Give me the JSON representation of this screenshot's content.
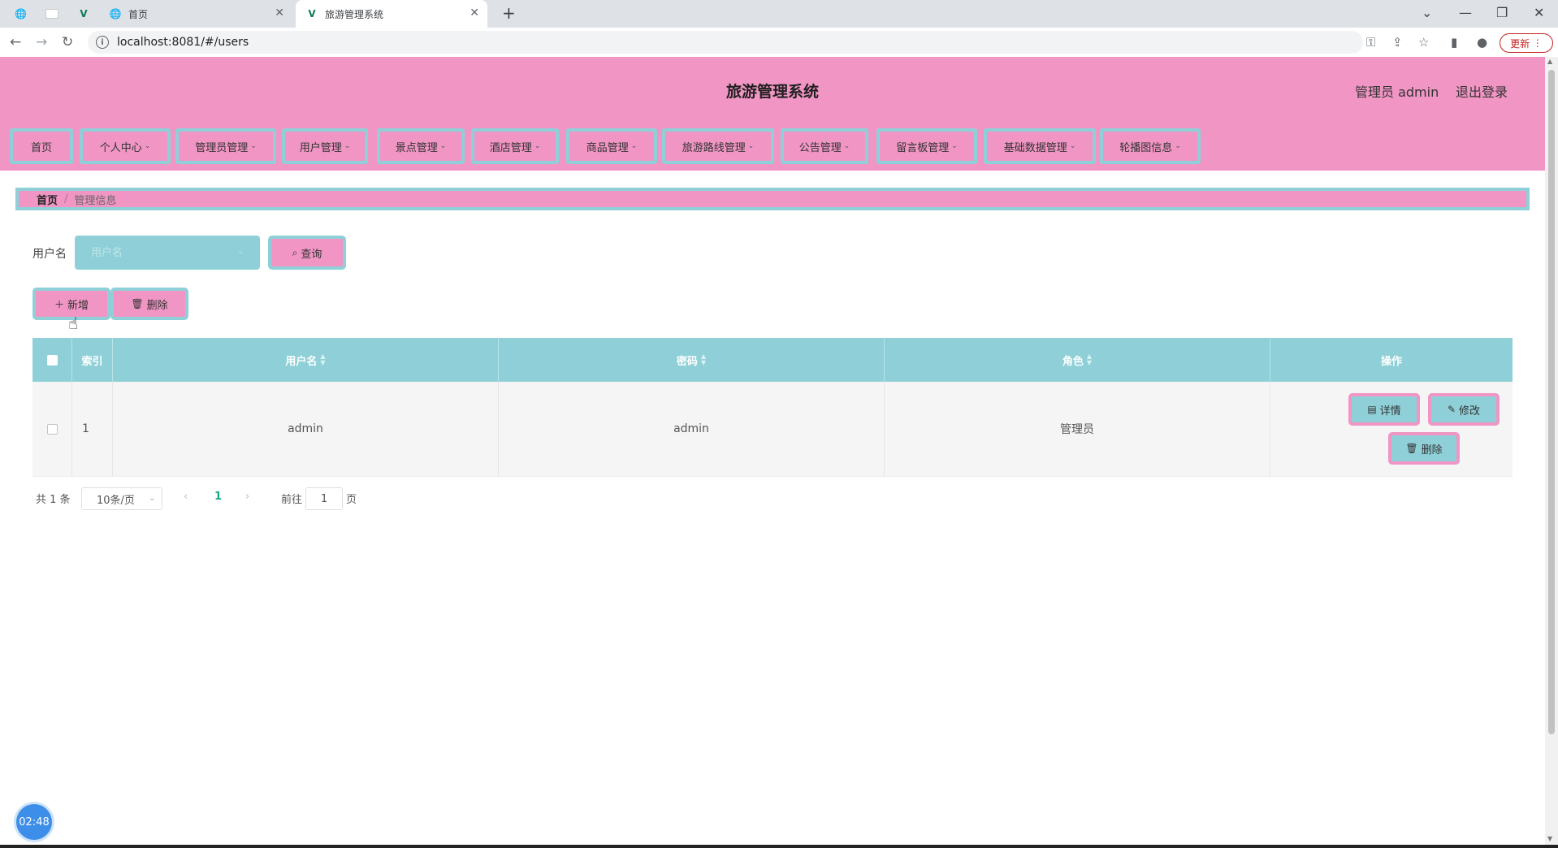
{
  "browser": {
    "tabs": [
      {
        "label": ""
      },
      {
        "label": ""
      },
      {
        "label": ""
      },
      {
        "label": "首页"
      },
      {
        "label": "旅游管理系统"
      }
    ],
    "url": "localhost:8081/#/users",
    "update_label": "更新"
  },
  "app": {
    "title": "旅游管理系统",
    "user_info": "管理员 admin",
    "logout": "退出登录"
  },
  "menu": [
    {
      "label": "首页",
      "has_dropdown": false
    },
    {
      "label": "个人中心",
      "has_dropdown": true
    },
    {
      "label": "管理员管理",
      "has_dropdown": true
    },
    {
      "label": "用户管理",
      "has_dropdown": true
    },
    {
      "label": "景点管理",
      "has_dropdown": true
    },
    {
      "label": "酒店管理",
      "has_dropdown": true
    },
    {
      "label": "商品管理",
      "has_dropdown": true
    },
    {
      "label": "旅游路线管理",
      "has_dropdown": true
    },
    {
      "label": "公告管理",
      "has_dropdown": true
    },
    {
      "label": "留言板管理",
      "has_dropdown": true
    },
    {
      "label": "基础数据管理",
      "has_dropdown": true
    },
    {
      "label": "轮播图信息",
      "has_dropdown": true
    }
  ],
  "breadcrumb": {
    "home": "首页",
    "sep": "/",
    "current": "管理信息"
  },
  "search": {
    "label": "用户名",
    "placeholder": "用户名",
    "button": "查询"
  },
  "actions": {
    "add": "新增",
    "delete": "删除"
  },
  "table": {
    "headers": {
      "index": "索引",
      "username": "用户名",
      "password": "密码",
      "role": "角色",
      "ops": "操作"
    },
    "rows": [
      {
        "index": "1",
        "username": "admin",
        "password": "admin",
        "role": "管理员"
      }
    ],
    "row_actions": {
      "detail": "详情",
      "edit": "修改",
      "delete": "删除"
    }
  },
  "pagination": {
    "total": "共 1 条",
    "page_size": "10条/页",
    "current_page": "1",
    "goto_prefix": "前往",
    "goto_value": "1",
    "goto_suffix": "页"
  },
  "clock": "02:48",
  "colors": {
    "pink": "#f095c4",
    "teal": "#8fd0d8",
    "active_page": "#17a689"
  }
}
